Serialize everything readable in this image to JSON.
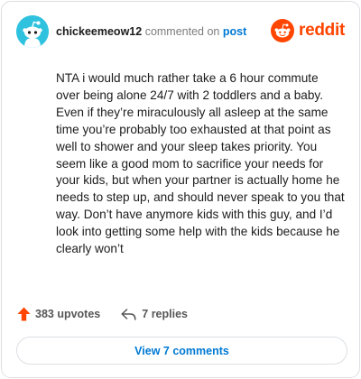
{
  "header": {
    "username": "chickeemeow12",
    "action_text": "commented on",
    "post_link": "post"
  },
  "brand": {
    "wordmark": "reddit",
    "color": "#ff4500"
  },
  "comment": {
    "text": "NTA i would much rather take a 6 hour commute over being alone 24/7 with 2 toddlers and a baby. Even if they’re miraculously all asleep at the same time you’re probably too exhausted at that point as well to shower and your sleep takes priority. You seem like a good mom to sacrifice your needs for your kids, but when your partner is actually home he needs to step up, and should never speak to you that way. Don’t have anymore kids with this guy, and I’d look into getting some help with the kids because he clearly won’t"
  },
  "actions": {
    "upvotes_label": "383 upvotes",
    "replies_label": "7 replies"
  },
  "footer": {
    "view_comments_label": "View 7 comments"
  },
  "colors": {
    "avatar_bg": "#2fc2df",
    "upvote_arrow": "#ff4500",
    "link_blue": "#0079d3"
  },
  "icons": [
    "snoo-avatar-icon",
    "reddit-logo-icon",
    "upvote-arrow-icon",
    "reply-arrow-icon"
  ]
}
